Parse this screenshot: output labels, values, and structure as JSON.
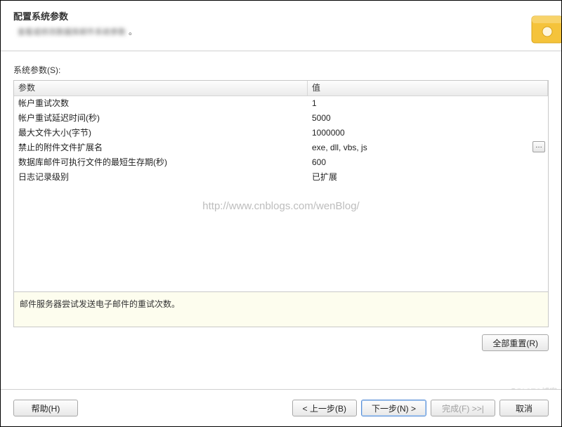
{
  "header": {
    "title": "配置系统参数",
    "subtitle_placeholder": "查看或修改数据库邮件系统参数"
  },
  "section_label": "系统参数(S):",
  "columns": {
    "param": "参数",
    "value": "值"
  },
  "rows": [
    {
      "name": "帐户重试次数",
      "value": "1"
    },
    {
      "name": "帐户重试延迟时间(秒)",
      "value": "5000"
    },
    {
      "name": "最大文件大小(字节)",
      "value": "1000000"
    },
    {
      "name": "禁止的附件文件扩展名",
      "value": "exe, dll, vbs, js",
      "has_button": true
    },
    {
      "name": "数据库邮件可执行文件的最短生存期(秒)",
      "value": "600"
    },
    {
      "name": "日志记录级别",
      "value": "已扩展"
    }
  ],
  "description": "邮件服务器尝试发送电子邮件的重试次数。",
  "watermark": "http://www.cnblogs.com/wenBlog/",
  "corner_mark": "@51CTO博客",
  "buttons": {
    "reset_all": "全部重置(R)",
    "help": "帮助(H)",
    "back": "< 上一步(B)",
    "next": "下一步(N) >",
    "finish": "完成(F) >>|",
    "cancel": "取消"
  }
}
